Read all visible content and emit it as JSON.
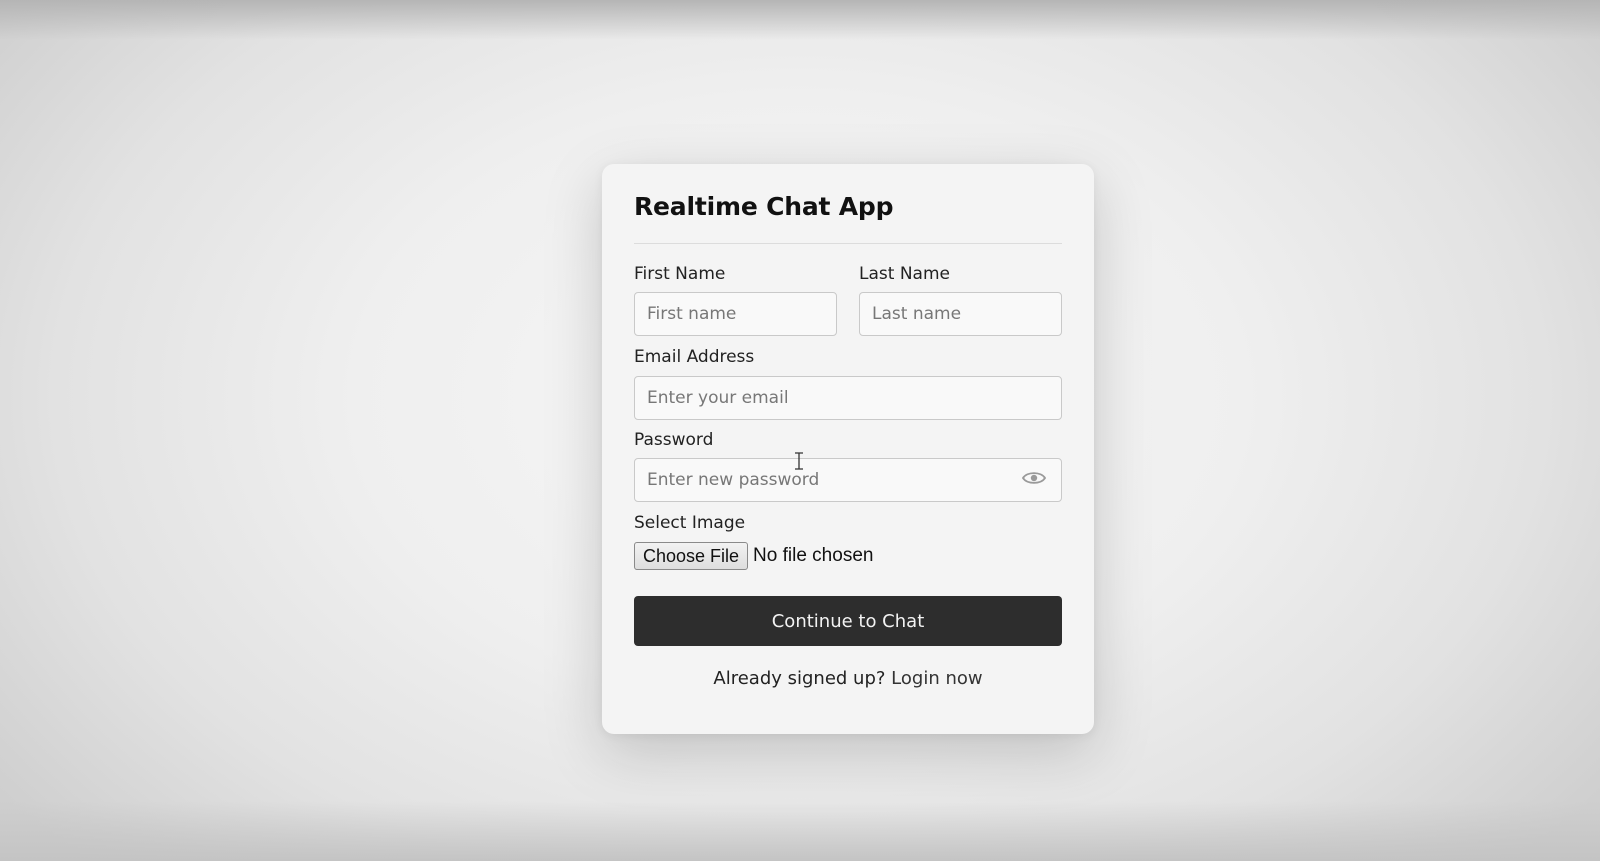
{
  "card": {
    "title": "Realtime Chat App"
  },
  "form": {
    "first_name": {
      "label": "First Name",
      "placeholder": "First name",
      "value": ""
    },
    "last_name": {
      "label": "Last Name",
      "placeholder": "Last name",
      "value": ""
    },
    "email": {
      "label": "Email Address",
      "placeholder": "Enter your email",
      "value": ""
    },
    "password": {
      "label": "Password",
      "placeholder": "Enter new password",
      "value": "",
      "toggle_icon": "eye-icon"
    },
    "image": {
      "label": "Select Image",
      "button_label": "Choose File",
      "status": "No file chosen"
    },
    "submit_label": "Continue to Chat"
  },
  "footer": {
    "prompt": "Already signed up?",
    "link_label": "Login now"
  },
  "colors": {
    "button_bg": "#2d2d2d",
    "card_bg": "#f4f4f4"
  },
  "cursor_icon": "text-cursor-icon"
}
